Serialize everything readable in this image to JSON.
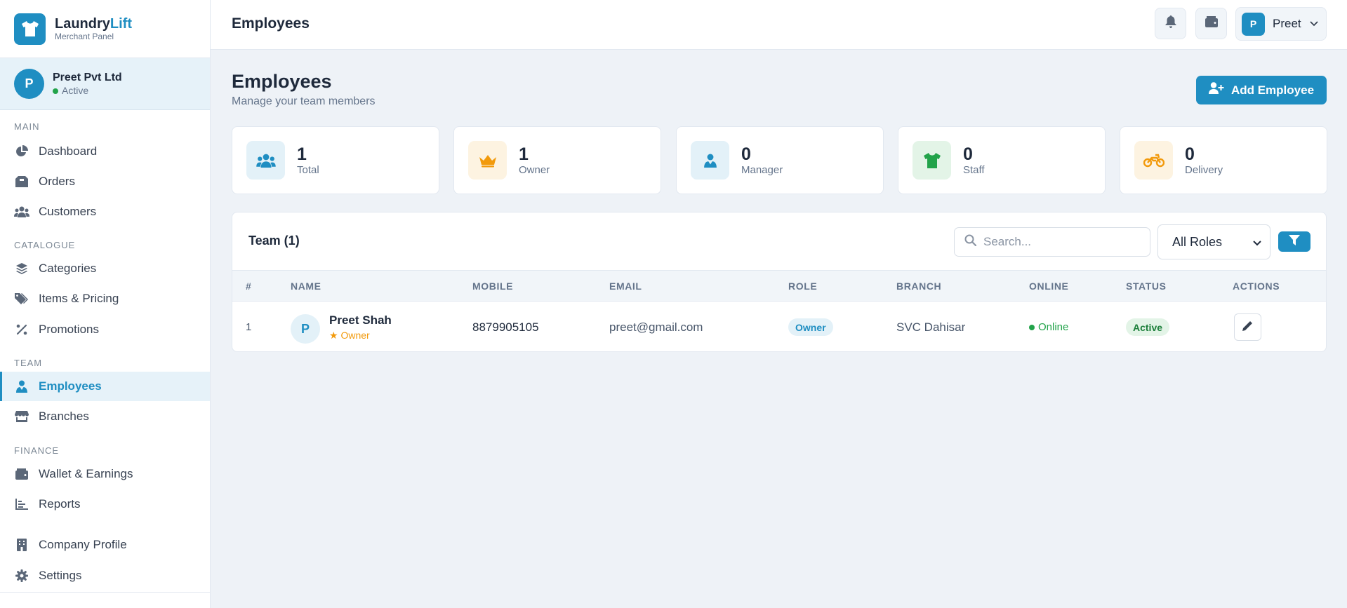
{
  "brand": {
    "name_part1": "Laundry",
    "name_part2": "Lift",
    "subtitle": "Merchant Panel",
    "color": "#1f8ec2"
  },
  "company": {
    "avatar_letter": "P",
    "name": "Preet Pvt Ltd",
    "status": "Active"
  },
  "sidebar": {
    "sections": {
      "main": "MAIN",
      "catalogue": "CATALOGUE",
      "team": "TEAM",
      "finance": "FINANCE"
    },
    "items": {
      "dashboard": {
        "label": "Dashboard",
        "icon": "chart-pie-icon"
      },
      "orders": {
        "label": "Orders",
        "icon": "box-icon"
      },
      "customers": {
        "label": "Customers",
        "icon": "users-icon"
      },
      "categories": {
        "label": "Categories",
        "icon": "layers-icon"
      },
      "items_pricing": {
        "label": "Items & Pricing",
        "icon": "tags-icon"
      },
      "promotions": {
        "label": "Promotions",
        "icon": "percent-icon"
      },
      "employees": {
        "label": "Employees",
        "icon": "user-tie-icon",
        "active": true
      },
      "branches": {
        "label": "Branches",
        "icon": "store-icon"
      },
      "wallet": {
        "label": "Wallet & Earnings",
        "icon": "wallet-icon"
      },
      "reports": {
        "label": "Reports",
        "icon": "bar-chart-icon"
      },
      "company_profile": {
        "label": "Company Profile",
        "icon": "building-icon"
      },
      "settings": {
        "label": "Settings",
        "icon": "gear-icon"
      }
    }
  },
  "topbar": {
    "title": "Employees",
    "user": {
      "avatar_letter": "P",
      "name": "Preet"
    }
  },
  "page": {
    "title": "Employees",
    "subtitle": "Manage your team members",
    "add_button": "Add Employee"
  },
  "stats": [
    {
      "value": "1",
      "label": "Total",
      "icon": "users-icon",
      "color": "#1f8ec2",
      "bg": "#e3f1f8"
    },
    {
      "value": "1",
      "label": "Owner",
      "icon": "crown-icon",
      "color": "#f29a0c",
      "bg": "#fdf3e1"
    },
    {
      "value": "0",
      "label": "Manager",
      "icon": "user-tie-icon",
      "color": "#1f8ec2",
      "bg": "#e3f1f8"
    },
    {
      "value": "0",
      "label": "Staff",
      "icon": "shirt-icon",
      "color": "#22a34a",
      "bg": "#e3f4e7"
    },
    {
      "value": "0",
      "label": "Delivery",
      "icon": "motorcycle-icon",
      "color": "#f29a0c",
      "bg": "#fdf3e1"
    }
  ],
  "team": {
    "title": "Team (1)",
    "search_placeholder": "Search...",
    "role_filter": "All Roles",
    "columns": {
      "num": "#",
      "name": "NAME",
      "mobile": "MOBILE",
      "email": "EMAIL",
      "role": "ROLE",
      "branch": "BRANCH",
      "online": "ONLINE",
      "status": "STATUS",
      "actions": "ACTIONS"
    },
    "rows": [
      {
        "num": "1",
        "avatar_letter": "P",
        "name": "Preet Shah",
        "role_tag": "★ Owner",
        "mobile": "8879905105",
        "email": "preet@gmail.com",
        "role": "Owner",
        "branch": "SVC Dahisar",
        "online": "Online",
        "status": "Active"
      }
    ]
  }
}
